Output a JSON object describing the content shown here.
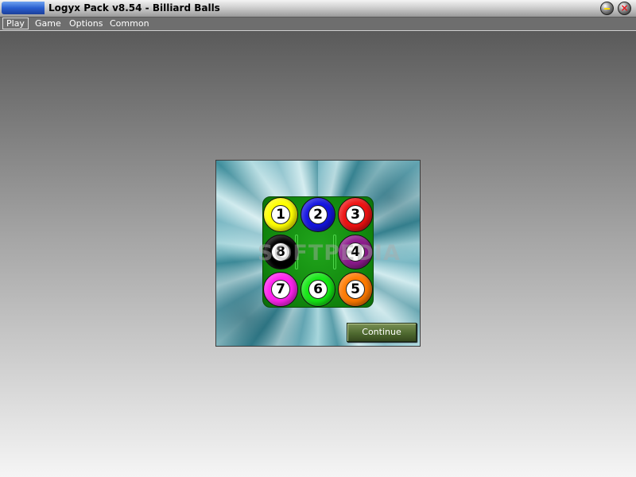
{
  "window": {
    "title": "Logyx Pack v8.54 - Billiard Balls",
    "minimize_icon": "minimize-icon",
    "close_icon": "close-icon",
    "close_glyph": "×"
  },
  "menu": {
    "items": [
      {
        "label": "Play",
        "active": true
      },
      {
        "label": "Game",
        "active": false
      },
      {
        "label": "Options",
        "active": false
      },
      {
        "label": "Common",
        "active": false
      }
    ]
  },
  "game": {
    "balls": [
      {
        "number": "1",
        "color": "#ffff00"
      },
      {
        "number": "2",
        "color": "#1414e0"
      },
      {
        "number": "3",
        "color": "#ee1111"
      },
      {
        "number": "8",
        "color": "#000000"
      },
      {
        "number": "4",
        "color": "#8c1a8c"
      },
      {
        "number": "7",
        "color": "#ff22ee"
      },
      {
        "number": "6",
        "color": "#14e814"
      },
      {
        "number": "5",
        "color": "#ff7a00"
      }
    ],
    "watermark": "SOFTPEDIA",
    "continue_label": "Continue"
  }
}
